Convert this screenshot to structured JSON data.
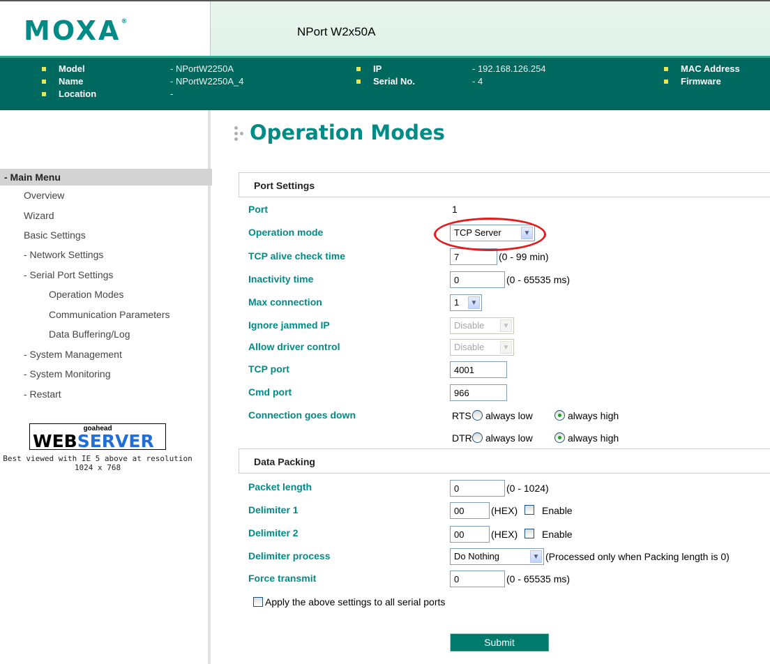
{
  "header": {
    "logo_text": "MOXA",
    "logo_mark": "®",
    "product_title": "NPort W2x50A"
  },
  "device_info": {
    "model_label": "Model",
    "model_value": "- NPortW2250A",
    "name_label": "Name",
    "name_value": "- NPortW2250A_4",
    "location_label": "Location",
    "location_value": "-",
    "ip_label": "IP",
    "ip_value": "- 192.168.126.254",
    "serial_label": "Serial No.",
    "serial_value": "- 4",
    "mac_label": "MAC Address",
    "firmware_label": "Firmware"
  },
  "sidebar": {
    "menu_title": "- Main Menu",
    "items": [
      "Overview",
      "Wizard",
      "Basic Settings",
      "- Network Settings",
      "- Serial Port Settings",
      "Operation Modes",
      "Communication Parameters",
      "Data Buffering/Log",
      "- System Management",
      "- System Monitoring",
      "- Restart"
    ],
    "badge_top": "goahead",
    "badge_web": "WEB",
    "badge_server": "SERVER",
    "best_viewed": "Best viewed with IE 5 above at resolution 1024 x 768"
  },
  "page": {
    "title": "Operation Modes"
  },
  "port_settings": {
    "section_title": "Port Settings",
    "port_label": "Port",
    "port_value": "1",
    "operation_mode_label": "Operation mode",
    "operation_mode_value": "TCP Server",
    "tcp_alive_label": "TCP alive check time",
    "tcp_alive_value": "7",
    "tcp_alive_hint": "(0 - 99 min)",
    "inactivity_label": "Inactivity time",
    "inactivity_value": "0",
    "inactivity_hint": "(0 - 65535 ms)",
    "max_conn_label": "Max connection",
    "max_conn_value": "1",
    "ignore_jammed_label": "Ignore jammed IP",
    "ignore_jammed_value": "Disable",
    "allow_driver_label": "Allow driver control",
    "allow_driver_value": "Disable",
    "tcp_port_label": "TCP port",
    "tcp_port_value": "4001",
    "cmd_port_label": "Cmd port",
    "cmd_port_value": "966",
    "conn_down_label": "Connection goes down",
    "rts_label": "RTS",
    "dtr_label": "DTR",
    "always_low": "always low",
    "always_high": "always high",
    "rts_selected": "always high",
    "dtr_selected": "always high"
  },
  "data_packing": {
    "section_title": "Data Packing",
    "packet_length_label": "Packet length",
    "packet_length_value": "0",
    "packet_length_hint": "(0 - 1024)",
    "delim1_label": "Delimiter 1",
    "delim1_value": "00",
    "hex_hint": "(HEX)",
    "enable_label": "Enable",
    "delim2_label": "Delimiter 2",
    "delim2_value": "00",
    "delim_process_label": "Delimiter process",
    "delim_process_value": "Do Nothing",
    "delim_process_hint": "(Processed only when Packing length is 0)",
    "force_tx_label": "Force transmit",
    "force_tx_value": "0",
    "force_tx_hint": "(0 - 65535 ms)"
  },
  "apply_all_label": "Apply the above settings to all serial ports",
  "submit_label": "Submit",
  "colors": {
    "brand_teal": "#008b87",
    "info_bar": "#00695f",
    "highlight_red": "#e8191b"
  }
}
